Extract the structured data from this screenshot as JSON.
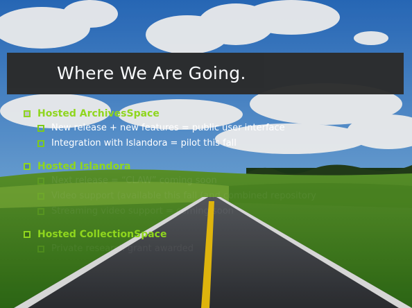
{
  "slide": {
    "title": "Where We Are Going.",
    "sections": [
      {
        "heading": "Hosted ArchivesSpace",
        "items": [
          "New release + new features = public user interface",
          "Integration with Islandora = pilot this fall"
        ]
      },
      {
        "heading": "Hosted Islandora",
        "items": [
          "Next release = “CLAW” coming soon",
          "Video support (available this fall (and combined repository",
          "Streaming video support = coming soon"
        ]
      },
      {
        "heading": "Hosted CollectionSpace",
        "items": [
          "Private research grant awarded"
        ]
      }
    ]
  },
  "colors": {
    "bullet_green": "#8fd61e",
    "title_bar": "#2b2b2b"
  }
}
